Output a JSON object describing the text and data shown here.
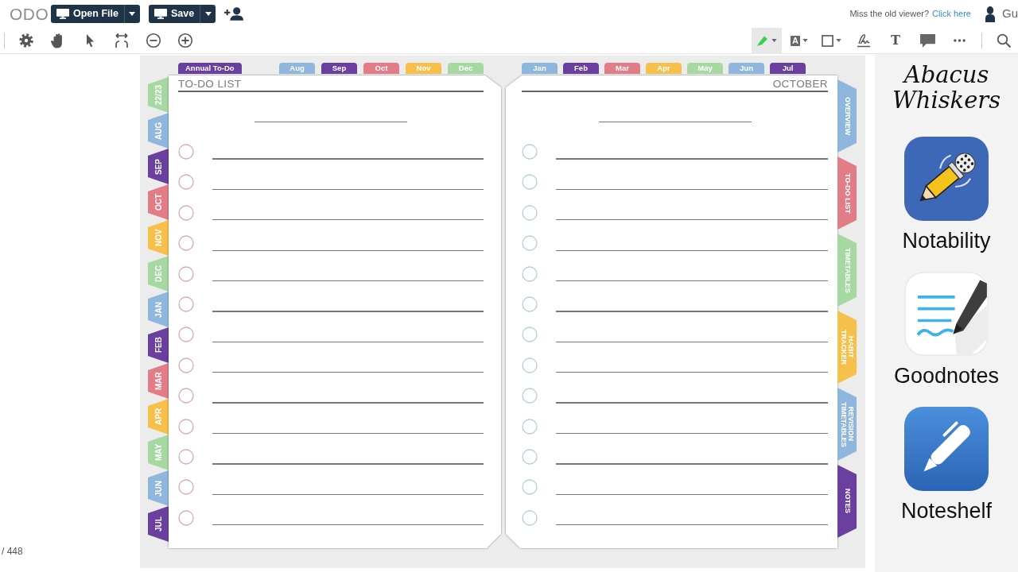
{
  "header": {
    "logo": "ODO",
    "actions": [
      {
        "label": "Open File"
      },
      {
        "label": "Save"
      }
    ],
    "notice": "Miss the old viewer?",
    "notice_link": "Click here",
    "user": "Gu"
  },
  "annotation_tools": [
    {
      "kind": "highlighter",
      "selected": true
    },
    {
      "kind": "text-box",
      "glyph": "A",
      "selected": false
    },
    {
      "kind": "shape",
      "selected": false
    },
    {
      "kind": "signature",
      "selected": false
    },
    {
      "kind": "free-text",
      "glyph": "T",
      "selected": false
    },
    {
      "kind": "comment",
      "selected": false
    },
    {
      "kind": "more",
      "selected": false
    }
  ],
  "planner": {
    "month_tabs": [
      {
        "label": "22/23",
        "color": "#a6d9a2"
      },
      {
        "label": "AUG",
        "color": "#8fb7dd"
      },
      {
        "label": "SEP",
        "color": "#6b3f9f"
      },
      {
        "label": "OCT",
        "color": "#e27c87"
      },
      {
        "label": "NOV",
        "color": "#f7c04a"
      },
      {
        "label": "DEC",
        "color": "#a6d9a2"
      },
      {
        "label": "JAN",
        "color": "#8fb7dd"
      },
      {
        "label": "FEB",
        "color": "#6b3f9f"
      },
      {
        "label": "MAR",
        "color": "#e27c87"
      },
      {
        "label": "APR",
        "color": "#f7c04a"
      },
      {
        "label": "MAY",
        "color": "#a6d9a2"
      },
      {
        "label": "JUN",
        "color": "#8fb7dd"
      },
      {
        "label": "JUL",
        "color": "#6b3f9f"
      }
    ],
    "pages": [
      {
        "kind": "todo",
        "tabs": [
          {
            "label": "Annual To-Do",
            "color": "#6b3f9f"
          },
          {
            "label": "Aug",
            "color": "#8fb7dd"
          },
          {
            "label": "Sep",
            "color": "#6b3f9f"
          },
          {
            "label": "Oct",
            "color": "#e27c87"
          },
          {
            "label": "Nov",
            "color": "#f7c04a"
          },
          {
            "label": "Dec",
            "color": "#a6d9a2"
          }
        ],
        "title": "TO-DO LIST",
        "color": "#dca7af",
        "items": [
          {
            "checked": false
          },
          {
            "checked": false
          },
          {
            "checked": false
          },
          {
            "checked": false
          },
          {
            "checked": false
          },
          {
            "checked": false
          },
          {
            "checked": false
          },
          {
            "checked": false
          },
          {
            "checked": false
          },
          {
            "checked": false
          },
          {
            "checked": false
          },
          {
            "checked": false
          },
          {
            "checked": false
          }
        ]
      },
      {
        "kind": "month",
        "tabs": [
          {
            "label": "Jan",
            "color": "#8fb7dd"
          },
          {
            "label": "Feb",
            "color": "#6b3f9f"
          },
          {
            "label": "Mar",
            "color": "#e27c87"
          },
          {
            "label": "Apr",
            "color": "#f7c04a"
          },
          {
            "label": "May",
            "color": "#a6d9a2"
          },
          {
            "label": "Jun",
            "color": "#8fb7dd"
          },
          {
            "label": "Jul",
            "color": "#6b3f9f"
          }
        ],
        "title": "OCTOBER",
        "color": "#b3cddb",
        "items": [
          {
            "checked": false
          },
          {
            "checked": false
          },
          {
            "checked": false
          },
          {
            "checked": false
          },
          {
            "checked": false
          },
          {
            "checked": false
          },
          {
            "checked": false
          },
          {
            "checked": false
          },
          {
            "checked": false
          },
          {
            "checked": false
          },
          {
            "checked": false
          },
          {
            "checked": false
          },
          {
            "checked": false
          }
        ]
      }
    ],
    "section_tabs": [
      {
        "label": "OVERVIEW",
        "color": "#8fb7dd"
      },
      {
        "label": "TO-DO LIST",
        "color": "#e27c87"
      },
      {
        "label": "TIMETABLES",
        "color": "#a6d9a2"
      },
      {
        "label": "HABIT TRACKER",
        "color": "#f7c04a"
      },
      {
        "label": "REVISION TIMETABLES",
        "color": "#8fb7dd"
      },
      {
        "label": "NOTES",
        "color": "#6b3f9f"
      }
    ]
  },
  "apps_panel": {
    "brand": "Abacus Whiskers",
    "apps": [
      {
        "kind": "pencil-mic",
        "name": "Notability"
      },
      {
        "kind": "pen-lines",
        "name": "Goodnotes"
      },
      {
        "kind": "pen",
        "name": "Noteshelf"
      }
    ]
  },
  "page_count": "/ 448"
}
